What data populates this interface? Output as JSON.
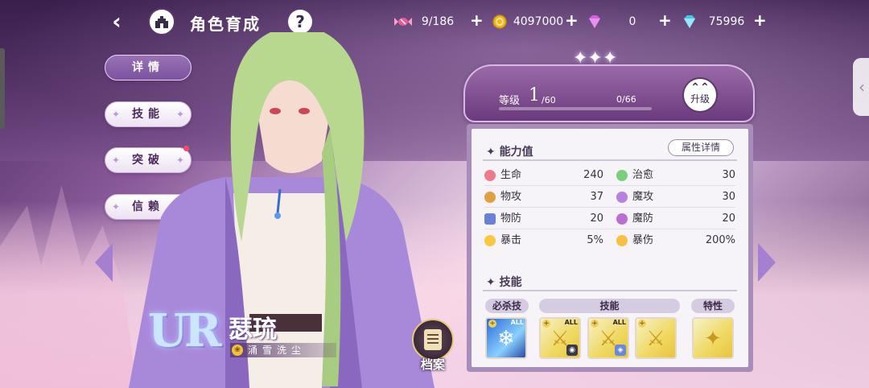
{
  "header": {
    "title": "角色育成",
    "back_icon": "back-arrow-icon",
    "home_icon": "castle-home-icon",
    "help_label": "?"
  },
  "resources": [
    {
      "name": "candy",
      "icon": "candy-icon",
      "value": "9/186",
      "color": "#e85a9a"
    },
    {
      "name": "gold",
      "icon": "gold-coin-icon",
      "value": "4097000",
      "color": "#f0b820"
    },
    {
      "name": "pink-gem",
      "icon": "pink-diamond-icon",
      "value": "0",
      "color": "#d060e0"
    },
    {
      "name": "blue-gem",
      "icon": "blue-diamond-icon",
      "value": "75996",
      "color": "#40c8f0"
    }
  ],
  "plus_label": "+",
  "menu": [
    {
      "label": "详情",
      "active": true
    },
    {
      "label": "技能",
      "active": false
    },
    {
      "label": "突破",
      "active": false,
      "badge": true
    },
    {
      "label": "信赖",
      "active": false
    }
  ],
  "character": {
    "rarity": "UR",
    "name": "瑟琉",
    "title": "涌雪洗尘"
  },
  "archive_label": "档案",
  "level": {
    "label": "等级",
    "value": "1",
    "max": "/60",
    "exp": "0/66",
    "progress": 0.0,
    "upgrade_label": "升级"
  },
  "stats": {
    "section_title": "能力值",
    "detail_button": "属性详情",
    "rows": [
      {
        "name": "生命",
        "value": "240",
        "color": "#f07a8a"
      },
      {
        "name": "治愈",
        "value": "30",
        "color": "#7ad07a"
      },
      {
        "name": "物攻",
        "value": "37",
        "color": "#e0a040"
      },
      {
        "name": "魔攻",
        "value": "30",
        "color": "#b880e0"
      },
      {
        "name": "物防",
        "value": "20",
        "color": "#6a80d8"
      },
      {
        "name": "魔防",
        "value": "20",
        "color": "#b870d0"
      },
      {
        "name": "暴击",
        "value": "5%",
        "color": "#f8c840"
      },
      {
        "name": "暴伤",
        "value": "200%",
        "color": "#f8c040"
      }
    ]
  },
  "skills": {
    "section_title": "技能",
    "tag_ultimate": "必杀技",
    "tag_skill": "技能",
    "tag_trait": "特性",
    "all_label": "ALL",
    "plus_badge": "+"
  }
}
